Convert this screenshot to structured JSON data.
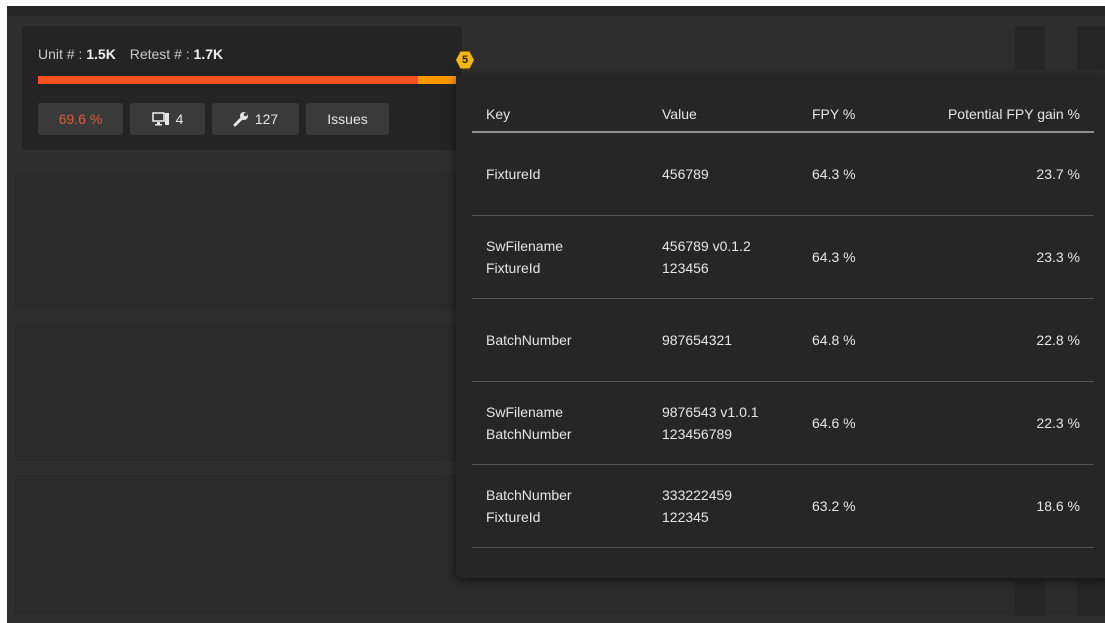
{
  "card": {
    "unit_label": "Unit # :",
    "unit_value": "1.5K",
    "retest_label": "Retest # :",
    "retest_value": "1.7K",
    "progress_fraction": 0.91,
    "colors": {
      "fill": "#f4511e",
      "track": "#ff9800",
      "badge": "#f5b80a",
      "fpy_text": "#e0583a"
    },
    "chips": {
      "fpy": "69.6 %",
      "stations_icon": "monitor-icon",
      "stations": "4",
      "fixtures_icon": "wrench-icon",
      "fixtures": "127",
      "issues": "Issues"
    },
    "badge_count": "5"
  },
  "popover": {
    "columns": [
      "Key",
      "Value",
      "FPY %",
      "Potential FPY gain %"
    ],
    "rows": [
      {
        "key": [
          "FixtureId"
        ],
        "value": [
          "456789"
        ],
        "fpy": "64.3 %",
        "gain": "23.7 %"
      },
      {
        "key": [
          "SwFilename",
          "FixtureId"
        ],
        "value": [
          "456789 v0.1.2",
          "123456"
        ],
        "fpy": "64.3 %",
        "gain": "23.3 %"
      },
      {
        "key": [
          "BatchNumber"
        ],
        "value": [
          "987654321"
        ],
        "fpy": "64.8 %",
        "gain": "22.8 %"
      },
      {
        "key": [
          "SwFilename",
          "BatchNumber"
        ],
        "value": [
          "9876543 v1.0.1",
          "123456789"
        ],
        "fpy": "64.6 %",
        "gain": "22.3 %"
      },
      {
        "key": [
          "BatchNumber",
          "FixtureId"
        ],
        "value": [
          "333222459",
          "122345"
        ],
        "fpy": "63.2 %",
        "gain": "18.6 %"
      }
    ]
  }
}
